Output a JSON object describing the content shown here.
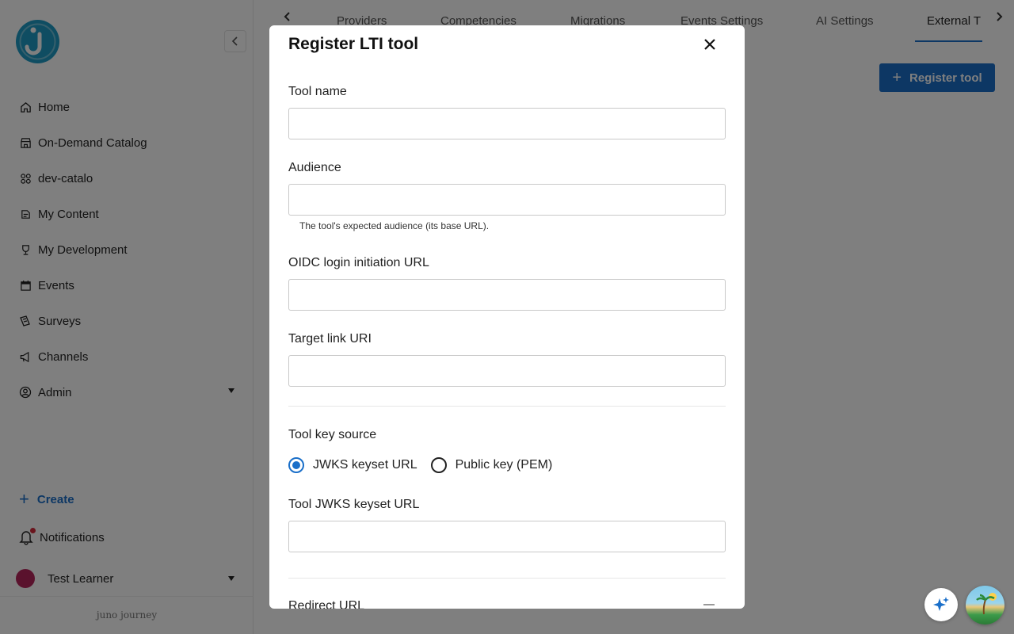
{
  "sidebar": {
    "items": [
      {
        "label": "Home",
        "icon": "home-icon"
      },
      {
        "label": "On-Demand Catalog",
        "icon": "catalog-icon"
      },
      {
        "label": "dev-catalo",
        "icon": "grid-icon"
      },
      {
        "label": "My Content",
        "icon": "content-icon"
      },
      {
        "label": "My Development",
        "icon": "trophy-icon"
      },
      {
        "label": "Events",
        "icon": "calendar-icon"
      },
      {
        "label": "Surveys",
        "icon": "survey-icon"
      },
      {
        "label": "Channels",
        "icon": "megaphone-icon"
      },
      {
        "label": "Admin",
        "icon": "admin-icon"
      }
    ],
    "create_label": "Create",
    "notifications_label": "Notifications",
    "user_name": "Test Learner",
    "footer_brand": "juno journey"
  },
  "tabs": [
    {
      "label": "Providers"
    },
    {
      "label": "Competencies"
    },
    {
      "label": "Migrations"
    },
    {
      "label": "Events Settings"
    },
    {
      "label": "AI Settings"
    },
    {
      "label": "External T"
    }
  ],
  "toolbar": {
    "register_label": "Register tool"
  },
  "modal": {
    "title": "Register LTI tool",
    "fields": {
      "tool_name": {
        "label": "Tool name",
        "value": ""
      },
      "audience": {
        "label": "Audience",
        "value": "",
        "helper": "The tool's expected audience (its base URL)."
      },
      "oidc": {
        "label": "OIDC login initiation URL",
        "value": ""
      },
      "target_link": {
        "label": "Target link URI",
        "value": ""
      },
      "key_source": {
        "label": "Tool key source",
        "options": [
          {
            "label": "JWKS keyset URL",
            "selected": true
          },
          {
            "label": "Public key (PEM)",
            "selected": false
          }
        ]
      },
      "jwks": {
        "label": "Tool JWKS keyset URL",
        "value": ""
      },
      "redirect": {
        "label": "Redirect URL"
      }
    }
  },
  "colors": {
    "accent": "#1a6fc9",
    "brand": "#1e9bc4",
    "notification_dot": "#d42a3b",
    "avatar": "#b4245a"
  }
}
